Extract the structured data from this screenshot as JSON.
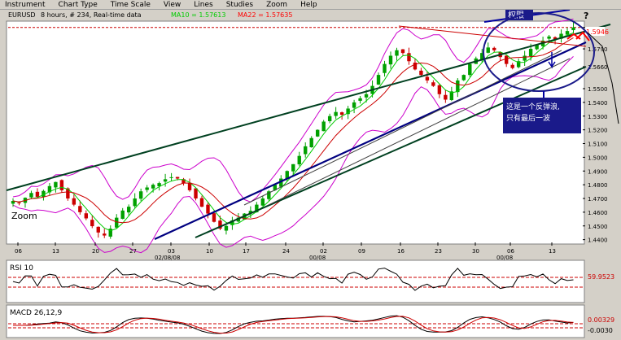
{
  "menu": [
    "Instrument",
    "Chart Type",
    "Time Scale",
    "View",
    "Lines",
    "Studies",
    "Zoom",
    "Help"
  ],
  "price_panel": {
    "symbol": "EURUSD",
    "period": "8 hours, # 234, Real-time data",
    "ma10_label": "MA10 = 1.57613",
    "ma22_label": "MA22 = 1.57635",
    "last_price": "1.5946",
    "zoom_label": "Zoom",
    "annotation_top": "权限",
    "annotation_question": "?",
    "annotation_note_line1": "这是一个反弹浪,",
    "annotation_note_line2": "只有最后一波"
  },
  "rsi_panel": {
    "title": "RSI 10",
    "value_label": "59.9523"
  },
  "macd_panel": {
    "title": "MACD 26,12,9",
    "value_label_top": "0.00329",
    "value_label_bottom": "-0.0030"
  },
  "colors": {
    "chart_bg": "#ffffff",
    "bull": "#00a000",
    "bear": "#cc0000",
    "ma10": "#00cc00",
    "ma22": "#cc0000",
    "bollinger": "#cc00cc",
    "trend_navy": "#000080",
    "trend_green": "#004020",
    "annotation": "#0000a0",
    "ma_text_green": "#00cc00",
    "ma_text_red": "#ff0000"
  },
  "chart_data": [
    {
      "type": "candlestick",
      "title": "EURUSD",
      "y_ticks": [
        "1.5946",
        "1.5790",
        "1.5660",
        "1.5500",
        "1.5400",
        "1.5300",
        "1.5200",
        "1.5100",
        "1.5000",
        "1.4900",
        "1.4800",
        "1.4700",
        "1.4600",
        "1.4500",
        "1.4400"
      ],
      "x_ticks": [
        "06",
        "13",
        "20",
        "27",
        "03",
        "10",
        "17",
        "24",
        "02",
        "09",
        "16",
        "23",
        "30",
        "06",
        "13"
      ],
      "x_period_labels": [
        "02/08/08",
        "00/08",
        "00/08"
      ],
      "ylim": [
        1.438,
        1.598
      ],
      "ohlc_from_price_path": [
        1.4682,
        1.4668,
        1.4705,
        1.474,
        1.4712,
        1.4755,
        1.479,
        1.482,
        1.476,
        1.47,
        1.4655,
        1.46,
        1.4555,
        1.4498,
        1.4452,
        1.443,
        1.448,
        1.456,
        1.4612,
        1.464,
        1.47,
        1.4752,
        1.478,
        1.48,
        1.4812,
        1.484,
        1.4855,
        1.4845,
        1.481,
        1.476,
        1.47,
        1.464,
        1.459,
        1.453,
        1.448,
        1.45,
        1.454,
        1.456,
        1.459,
        1.461,
        1.4655,
        1.47,
        1.4752,
        1.48,
        1.4845,
        1.49,
        1.495,
        1.501,
        1.508,
        1.514,
        1.52,
        1.526,
        1.53,
        1.533,
        1.531,
        1.5355,
        1.54,
        1.543,
        1.546,
        1.552,
        1.56,
        1.568,
        1.574,
        1.578,
        1.576,
        1.57,
        1.564,
        1.56,
        1.556,
        1.552,
        1.546,
        1.542,
        1.548,
        1.556,
        1.56,
        1.568,
        1.572,
        1.576,
        1.58,
        1.578,
        1.573,
        1.568,
        1.565,
        1.57,
        1.574,
        1.579,
        1.582,
        1.585,
        1.588,
        1.586,
        1.59,
        1.592,
        1.5946
      ]
    },
    {
      "type": "line",
      "title": "RSI 10",
      "ylim": [
        0,
        100
      ],
      "reference_lines": [
        30,
        70
      ],
      "last": 59.9523
    },
    {
      "type": "line",
      "title": "MACD 26,12,9",
      "reference_lines": [
        0
      ],
      "last": 0.00329
    }
  ]
}
